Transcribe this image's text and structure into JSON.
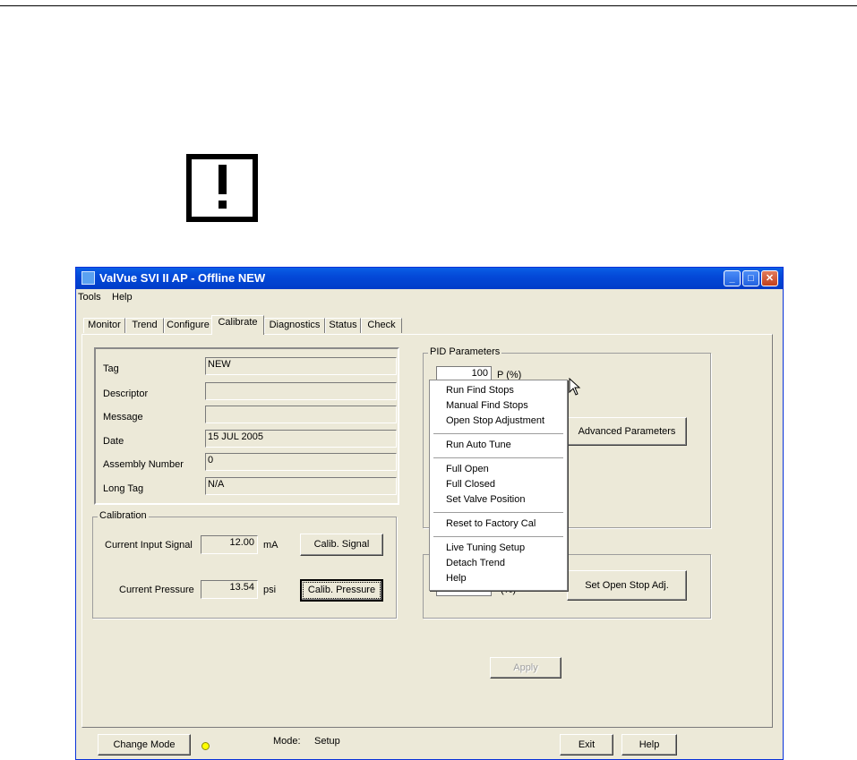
{
  "window": {
    "title": "ValVue SVI II AP - Offline  NEW",
    "controls": {
      "minimize": "_",
      "maximize": "□",
      "close": "✕"
    }
  },
  "menubar": {
    "items": [
      "Tools",
      "Help"
    ]
  },
  "tabs": [
    {
      "label": "Monitor",
      "active": false
    },
    {
      "label": "Trend",
      "active": false
    },
    {
      "label": "Configure",
      "active": false
    },
    {
      "label": "Calibrate",
      "active": true
    },
    {
      "label": "Diagnostics",
      "active": false
    },
    {
      "label": "Status",
      "active": false
    },
    {
      "label": "Check",
      "active": false
    }
  ],
  "info": {
    "rows": [
      {
        "label": "Tag",
        "value": "NEW"
      },
      {
        "label": "Descriptor",
        "value": ""
      },
      {
        "label": "Message",
        "value": ""
      },
      {
        "label": "Date",
        "value": "15 JUL 2005"
      },
      {
        "label": "Assembly Number",
        "value": "0"
      },
      {
        "label": "Long Tag",
        "value": "N/A"
      }
    ]
  },
  "calibration": {
    "title": "Calibration",
    "input_signal": {
      "label": "Current Input Signal",
      "value": "12.00",
      "unit": "mA",
      "button": "Calib. Signal"
    },
    "pressure": {
      "label": "Current Pressure",
      "value": "13.54",
      "unit": "psi",
      "button": "Calib. Pressure"
    }
  },
  "pid": {
    "title": "PID Parameters",
    "p_value": "100",
    "p_label": "P (%)",
    "advanced_button": "Advanced Parameters"
  },
  "stops": {
    "unit": "(%)",
    "set_open_stop_button": "Set Open Stop Adj."
  },
  "apply_button": "Apply",
  "context_menu": {
    "groups": [
      [
        "Run Find Stops",
        "Manual Find Stops",
        "Open Stop Adjustment"
      ],
      [
        "Run Auto Tune"
      ],
      [
        "Full Open",
        "Full Closed",
        "Set Valve Position"
      ],
      [
        "Reset to Factory Cal"
      ],
      [
        "Live Tuning Setup",
        "Detach Trend",
        "Help"
      ]
    ]
  },
  "footer": {
    "change_mode_button": "Change Mode",
    "mode_label": "Mode:",
    "mode_value": "Setup",
    "exit_button": "Exit",
    "help_button": "Help"
  },
  "colors": {
    "titlebar": "#0449d8",
    "window_bg": "#ece9d8",
    "mode_led": "#ffff00"
  }
}
